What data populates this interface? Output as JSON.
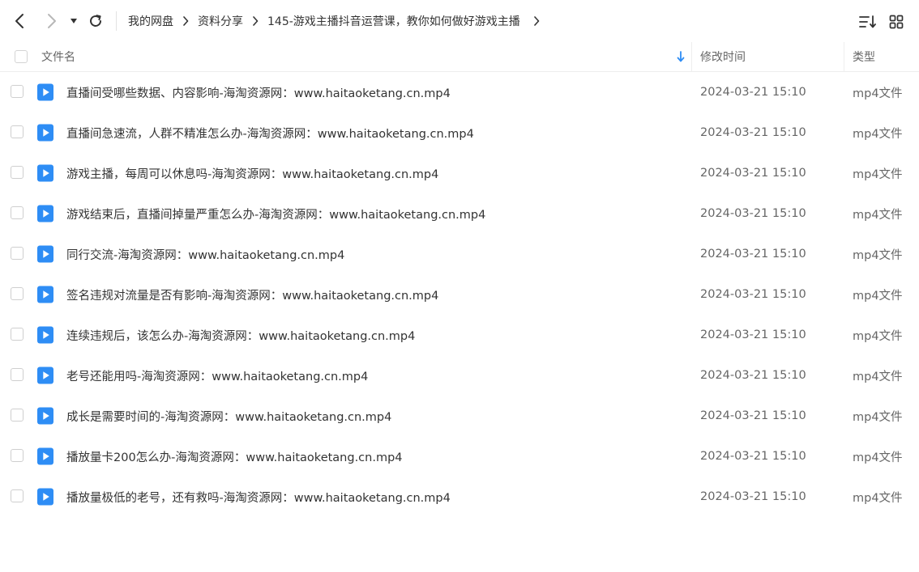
{
  "toolbar": {
    "back_icon": "chevron-left-icon",
    "forward_icon": "chevron-right-icon",
    "history_dropdown_icon": "caret-down-icon",
    "refresh_icon": "refresh-icon",
    "sort_icon": "sort-list-icon",
    "view_icon": "grid-view-icon"
  },
  "breadcrumb": [
    {
      "label": "我的网盘"
    },
    {
      "label": "资料分享"
    },
    {
      "label": "145-游戏主播抖音运营课，教你如何做好游戏主播"
    }
  ],
  "columns": {
    "name": "文件名",
    "modified": "修改时间",
    "type": "类型"
  },
  "colors": {
    "file_icon": "#2e8df5",
    "sort_arrow": "#2e8df5",
    "text": "#333333",
    "muted": "#666666"
  },
  "files": [
    {
      "name": "直播间受哪些数据、内容影响-海淘资源网：www.haitaoketang.cn.mp4",
      "modified": "2024-03-21 15:10",
      "type": "mp4文件"
    },
    {
      "name": "直播间急速流，人群不精准怎么办-海淘资源网：www.haitaoketang.cn.mp4",
      "modified": "2024-03-21 15:10",
      "type": "mp4文件"
    },
    {
      "name": "游戏主播，每周可以休息吗-海淘资源网：www.haitaoketang.cn.mp4",
      "modified": "2024-03-21 15:10",
      "type": "mp4文件"
    },
    {
      "name": "游戏结束后，直播间掉量严重怎么办-海淘资源网：www.haitaoketang.cn.mp4",
      "modified": "2024-03-21 15:10",
      "type": "mp4文件"
    },
    {
      "name": "同行交流-海淘资源网：www.haitaoketang.cn.mp4",
      "modified": "2024-03-21 15:10",
      "type": "mp4文件"
    },
    {
      "name": "签名违规对流量是否有影响-海淘资源网：www.haitaoketang.cn.mp4",
      "modified": "2024-03-21 15:10",
      "type": "mp4文件"
    },
    {
      "name": "连续违规后，该怎么办-海淘资源网：www.haitaoketang.cn.mp4",
      "modified": "2024-03-21 15:10",
      "type": "mp4文件"
    },
    {
      "name": "老号还能用吗-海淘资源网：www.haitaoketang.cn.mp4",
      "modified": "2024-03-21 15:10",
      "type": "mp4文件"
    },
    {
      "name": "成长是需要时间的-海淘资源网：www.haitaoketang.cn.mp4",
      "modified": "2024-03-21 15:10",
      "type": "mp4文件"
    },
    {
      "name": "播放量卡200怎么办-海淘资源网：www.haitaoketang.cn.mp4",
      "modified": "2024-03-21 15:10",
      "type": "mp4文件"
    },
    {
      "name": "播放量极低的老号，还有救吗-海淘资源网：www.haitaoketang.cn.mp4",
      "modified": "2024-03-21 15:10",
      "type": "mp4文件"
    }
  ]
}
